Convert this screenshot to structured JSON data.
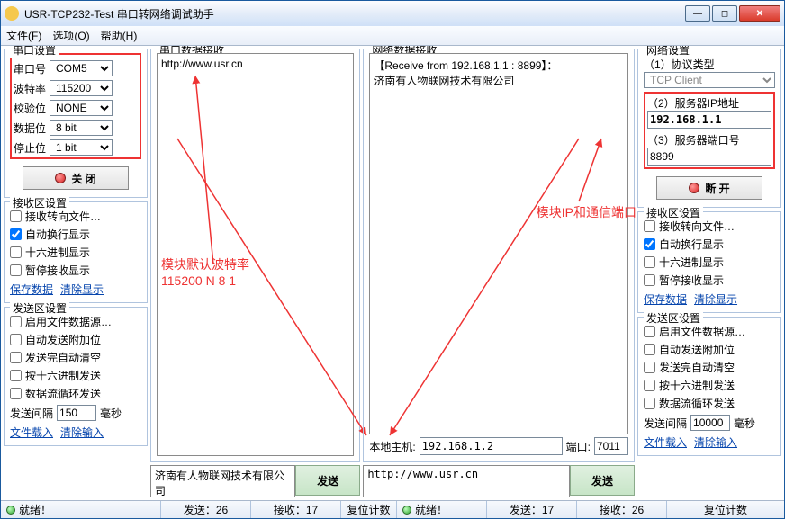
{
  "window": {
    "title": "USR-TCP232-Test 串口转网络调试助手"
  },
  "menu": {
    "file": "文件(F)",
    "options": "选项(O)",
    "help": "帮助(H)"
  },
  "serial": {
    "legend": "串口设置",
    "port_lbl": "串口号",
    "port": "COM5",
    "baud_lbl": "波特率",
    "baud": "115200",
    "parity_lbl": "校验位",
    "parity": "NONE",
    "data_lbl": "数据位",
    "data": "8 bit",
    "stop_lbl": "停止位",
    "stop": "1 bit",
    "close_btn": "关 闭"
  },
  "recv_opts": {
    "legend": "接收区设置",
    "to_file": "接收转向文件…",
    "auto_wrap": "自动换行显示",
    "hex": "十六进制显示",
    "pause": "暂停接收显示",
    "save": "保存数据",
    "clear": "清除显示"
  },
  "send_opts": {
    "legend": "发送区设置",
    "file_src": "启用文件数据源…",
    "auto_append": "自动发送附加位",
    "clear_after": "发送完自动清空",
    "hex_send": "按十六进制发送",
    "loop": "数据流循环发送",
    "interval_lbl": "发送间隔",
    "interval_val_left": "150",
    "interval_val_right": "10000",
    "interval_unit": "毫秒",
    "load_file": "文件载入",
    "clear_input": "清除输入"
  },
  "serial_recv": {
    "legend": "串口数据接收",
    "text": "http://www.usr.cn"
  },
  "net_recv": {
    "legend": "网络数据接收",
    "line1": "【Receive from 192.168.1.1 : 8899】：",
    "line2": "济南有人物联网技术有限公司"
  },
  "serial_send_text": "济南有人物联网技术有限公司",
  "net_send_text": "http://www.usr.cn",
  "send_btn": "发送",
  "hostrow": {
    "host_lbl": "本地主机:",
    "host": "192.168.1.2",
    "port_lbl": "端口:",
    "port": "7011"
  },
  "net": {
    "legend": "网络设置",
    "proto_lbl": "（1）协议类型",
    "proto": "TCP Client",
    "ip_lbl": "（2）服务器IP地址",
    "ip": "192.168.1.1",
    "port_lbl": "（3）服务器端口号",
    "port": "8899",
    "disc_btn": "断 开"
  },
  "annot": {
    "baud_note": "模块默认波特率\n115200 N 8 1",
    "ip_note": "模块IP和通信端口"
  },
  "status": {
    "ok": "就绪！",
    "sent": "发送：26",
    "recv": "接收：17",
    "sent2": "发送：17",
    "recv2": "接收：26",
    "reset": "复位计数"
  }
}
